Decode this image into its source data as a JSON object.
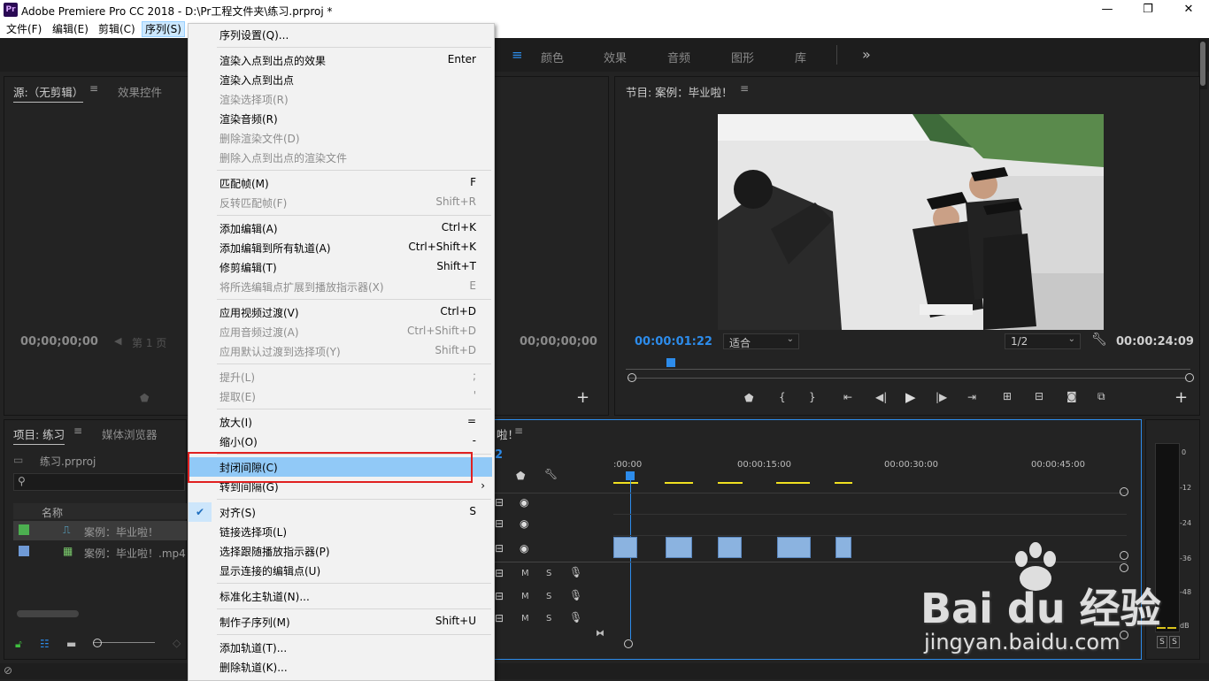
{
  "window": {
    "title": "Adobe Premiere Pro CC 2018 - D:\\Pr工程文件夹\\练习.prproj *",
    "logo": "Pr",
    "minimize": "—",
    "maximize": "❐",
    "close": "✕"
  },
  "menubar": {
    "items": [
      "文件(F)",
      "编辑(E)",
      "剪辑(C)",
      "序列(S)"
    ]
  },
  "workspaces": {
    "items": [
      "颜色",
      "效果",
      "音频",
      "图形",
      "库"
    ],
    "more": "»"
  },
  "source_panel": {
    "tab_source": "源:（无剪辑）",
    "tab_effects": "效果控件",
    "timecode_left": "00;00;00;00",
    "page_label": "第 1 页",
    "timecode_right": "00;00;00;00",
    "add": "+"
  },
  "program_panel": {
    "tab": "节目: 案例：毕业啦！",
    "timecode_current": "00:00:01:22",
    "fit": "适合",
    "resolution": "1/2",
    "timecode_total": "00:00:24:09",
    "add": "+"
  },
  "project_panel": {
    "tab_project": "项目: 练习",
    "tab_media": "媒体浏览器",
    "file": "练习.prproj",
    "column_name": "名称",
    "items": [
      {
        "name": "案例：毕业啦！",
        "color": "#4caf50"
      },
      {
        "name": "案例：毕业啦！.mp4",
        "color": "#6f9ad6"
      }
    ]
  },
  "timeline_panel": {
    "tab": "啦！",
    "timecode_digit": "2",
    "ruler": [
      ":00:00",
      "00:00:15:00",
      "00:00:30:00",
      "00:00:45:00"
    ],
    "audio_track_labels": [
      "M",
      "S"
    ]
  },
  "meter": {
    "scale": [
      "0",
      "-12",
      "-24",
      "-36",
      "-48",
      "dB"
    ],
    "solo": [
      "S",
      "S"
    ]
  },
  "sequence_menu": {
    "items": [
      {
        "label": "序列设置(Q)...",
        "shortcut": "",
        "disabled": false
      },
      {
        "sep": true
      },
      {
        "label": "渲染入点到出点的效果",
        "shortcut": "Enter",
        "disabled": false
      },
      {
        "label": "渲染入点到出点",
        "shortcut": "",
        "disabled": false
      },
      {
        "label": "渲染选择项(R)",
        "shortcut": "",
        "disabled": true
      },
      {
        "label": "渲染音频(R)",
        "shortcut": "",
        "disabled": false
      },
      {
        "label": "删除渲染文件(D)",
        "shortcut": "",
        "disabled": true
      },
      {
        "label": "删除入点到出点的渲染文件",
        "shortcut": "",
        "disabled": true
      },
      {
        "sep": true
      },
      {
        "label": "匹配帧(M)",
        "shortcut": "F",
        "disabled": false
      },
      {
        "label": "反转匹配帧(F)",
        "shortcut": "Shift+R",
        "disabled": true
      },
      {
        "sep": true
      },
      {
        "label": "添加编辑(A)",
        "shortcut": "Ctrl+K",
        "disabled": false
      },
      {
        "label": "添加编辑到所有轨道(A)",
        "shortcut": "Ctrl+Shift+K",
        "disabled": false
      },
      {
        "label": "修剪编辑(T)",
        "shortcut": "Shift+T",
        "disabled": false
      },
      {
        "label": "将所选编辑点扩展到播放指示器(X)",
        "shortcut": "E",
        "disabled": true
      },
      {
        "sep": true
      },
      {
        "label": "应用视频过渡(V)",
        "shortcut": "Ctrl+D",
        "disabled": false
      },
      {
        "label": "应用音频过渡(A)",
        "shortcut": "Ctrl+Shift+D",
        "disabled": true
      },
      {
        "label": "应用默认过渡到选择项(Y)",
        "shortcut": "Shift+D",
        "disabled": true
      },
      {
        "sep": true
      },
      {
        "label": "提升(L)",
        "shortcut": ";",
        "disabled": true
      },
      {
        "label": "提取(E)",
        "shortcut": "'",
        "disabled": true
      },
      {
        "sep": true
      },
      {
        "label": "放大(I)",
        "shortcut": "=",
        "disabled": false
      },
      {
        "label": "缩小(O)",
        "shortcut": "-",
        "disabled": false
      },
      {
        "sep": true
      },
      {
        "label": "封闭间隙(C)",
        "shortcut": "",
        "disabled": false,
        "highlight": true
      },
      {
        "label": "转到间隔(G)",
        "shortcut": "",
        "disabled": false,
        "submenu": true
      },
      {
        "sep": true
      },
      {
        "label": "对齐(S)",
        "shortcut": "S",
        "disabled": false,
        "checked": true
      },
      {
        "label": "链接选择项(L)",
        "shortcut": "",
        "disabled": false
      },
      {
        "label": "选择跟随播放指示器(P)",
        "shortcut": "",
        "disabled": false
      },
      {
        "label": "显示连接的编辑点(U)",
        "shortcut": "",
        "disabled": false
      },
      {
        "sep": true
      },
      {
        "label": "标准化主轨道(N)...",
        "shortcut": "",
        "disabled": false
      },
      {
        "sep": true
      },
      {
        "label": "制作子序列(M)",
        "shortcut": "Shift+U",
        "disabled": false
      },
      {
        "sep": true
      },
      {
        "label": "添加轨道(T)...",
        "shortcut": "",
        "disabled": false
      },
      {
        "label": "删除轨道(K)...",
        "shortcut": "",
        "disabled": false
      }
    ]
  },
  "watermark": {
    "brand": "Bai du 经验",
    "url": "jingyan.baidu.com"
  }
}
